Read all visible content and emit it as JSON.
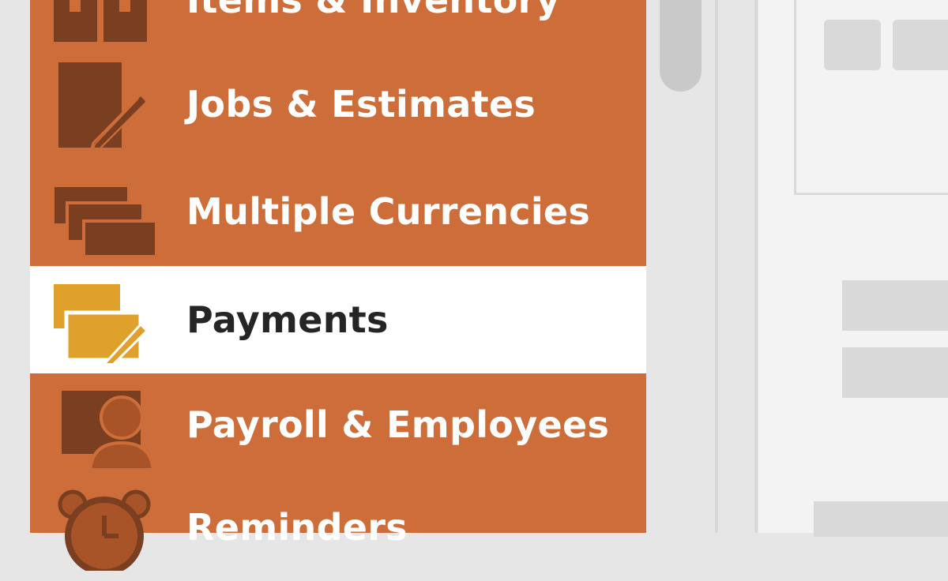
{
  "menu": {
    "items": [
      {
        "label": "Items & Inventory",
        "icon": "items-inventory-icon",
        "active": false
      },
      {
        "label": "Jobs & Estimates",
        "icon": "jobs-estimates-icon",
        "active": false
      },
      {
        "label": "Multiple Currencies",
        "icon": "multiple-currencies-icon",
        "active": false
      },
      {
        "label": "Payments",
        "icon": "payments-icon",
        "active": true
      },
      {
        "label": "Payroll & Employees",
        "icon": "payroll-employees-icon",
        "active": false
      },
      {
        "label": "Reminders",
        "icon": "reminders-icon",
        "active": false
      }
    ]
  },
  "colors": {
    "menu_bg": "#cd6d3a",
    "icon_dark": "#7a3e20",
    "active_bg": "#ffffff",
    "active_icon": "#dfa12b",
    "active_text": "#252525"
  }
}
